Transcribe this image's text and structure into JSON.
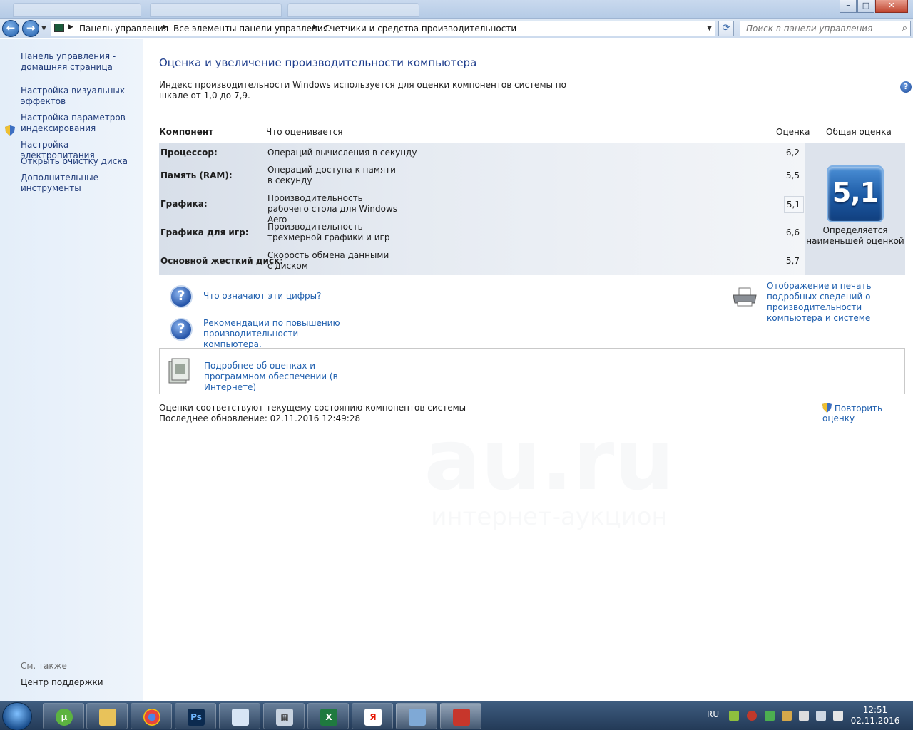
{
  "window": {
    "minimize_glyph": "–",
    "maximize_glyph": "□",
    "close_glyph": "✕"
  },
  "nav": {
    "back_glyph": "←",
    "forward_glyph": "→",
    "breadcrumb": [
      "Панель управления",
      "Все элементы панели управления",
      "Счетчики и средства производительности"
    ],
    "search_placeholder": "Поиск в панели управления"
  },
  "sidebar": {
    "items": [
      {
        "label": "Панель управления - домашняя страница"
      },
      {
        "label": "Настройка визуальных эффектов"
      },
      {
        "label": "Настройка параметров индексирования"
      },
      {
        "label": "Настройка электропитания"
      },
      {
        "label": "Открыть очистку диска"
      },
      {
        "label": "Дополнительные инструменты"
      }
    ],
    "see_also_label": "См. также",
    "see_also_items": [
      "Центр поддержки"
    ]
  },
  "main": {
    "title": "Оценка и увеличение производительности компьютера",
    "intro": "Индекс производительности Windows используется для оценки компонентов системы по шкале от 1,0 до 7,9.",
    "table": {
      "headers": {
        "component": "Компонент",
        "rated": "Что оценивается",
        "score": "Оценка",
        "overall": "Общая оценка"
      },
      "rows": [
        {
          "component": "Процессор:",
          "desc": "Операций вычисления в секунду",
          "score": "6,2"
        },
        {
          "component": "Память (RAM):",
          "desc": "Операций доступа к памяти в секунду",
          "score": "5,5"
        },
        {
          "component": "Графика:",
          "desc": "Производительность рабочего стола для Windows Aero",
          "score": "5,1"
        },
        {
          "component": "Графика для игр:",
          "desc": "Производительность трехмерной графики и игр",
          "score": "6,6"
        },
        {
          "component": "Основной жесткий диск:",
          "desc": "Скорость обмена данными с диском",
          "score": "5,7"
        }
      ],
      "overall_score": "5,1",
      "overall_caption": "Определяется наименьшей оценкой"
    },
    "links": {
      "what_mean": "Что означают эти цифры?",
      "tips": "Рекомендации по повышению производительности компьютера.",
      "print": "Отображение и печать подробных сведений о производительности компьютера и системе",
      "more_info": "Подробнее об оценках и программном обеспечении (в Интернете)"
    },
    "status_line1": "Оценки соответствуют текущему состоянию компонентов системы",
    "status_line2": "Последнее обновление: 02.11.2016 12:49:28",
    "repeat_label": "Повторить оценку"
  },
  "taskbar": {
    "apps": [
      "utorrent",
      "explorer",
      "chrome",
      "photoshop",
      "paint",
      "calculator",
      "excel",
      "yandex",
      "control-panel",
      "toolbox"
    ],
    "lang": "RU",
    "time": "12:51",
    "date": "02.11.2016"
  },
  "watermark": {
    "line1": "au.ru",
    "line2": "интернет-аукцион"
  }
}
